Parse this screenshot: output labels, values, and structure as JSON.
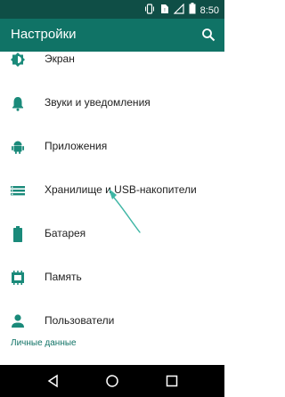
{
  "status_bar": {
    "time": "8:50",
    "icons": [
      "vibrate-icon",
      "no-sim-icon",
      "signal-icon",
      "battery-icon"
    ]
  },
  "app_bar": {
    "title": "Настройки",
    "search_icon": "search-icon"
  },
  "settings": {
    "items": [
      {
        "label": "Экран",
        "icon": "brightness-icon"
      },
      {
        "label": "Звуки и уведомления",
        "icon": "bell-icon"
      },
      {
        "label": "Приложения",
        "icon": "android-icon"
      },
      {
        "label": "Хранилище и USB-накопители",
        "icon": "storage-icon"
      },
      {
        "label": "Батарея",
        "icon": "battery-icon"
      },
      {
        "label": "Память",
        "icon": "memory-icon"
      },
      {
        "label": "Пользователи",
        "icon": "person-icon"
      }
    ],
    "section_header": "Личные данные"
  },
  "colors": {
    "status_bar": "#0f4e46",
    "app_bar": "#107366",
    "accent": "#1a8a7a",
    "arrow": "#3fb6a5"
  },
  "nav_bar": {
    "buttons": [
      "back-icon",
      "home-icon",
      "recents-icon"
    ]
  }
}
